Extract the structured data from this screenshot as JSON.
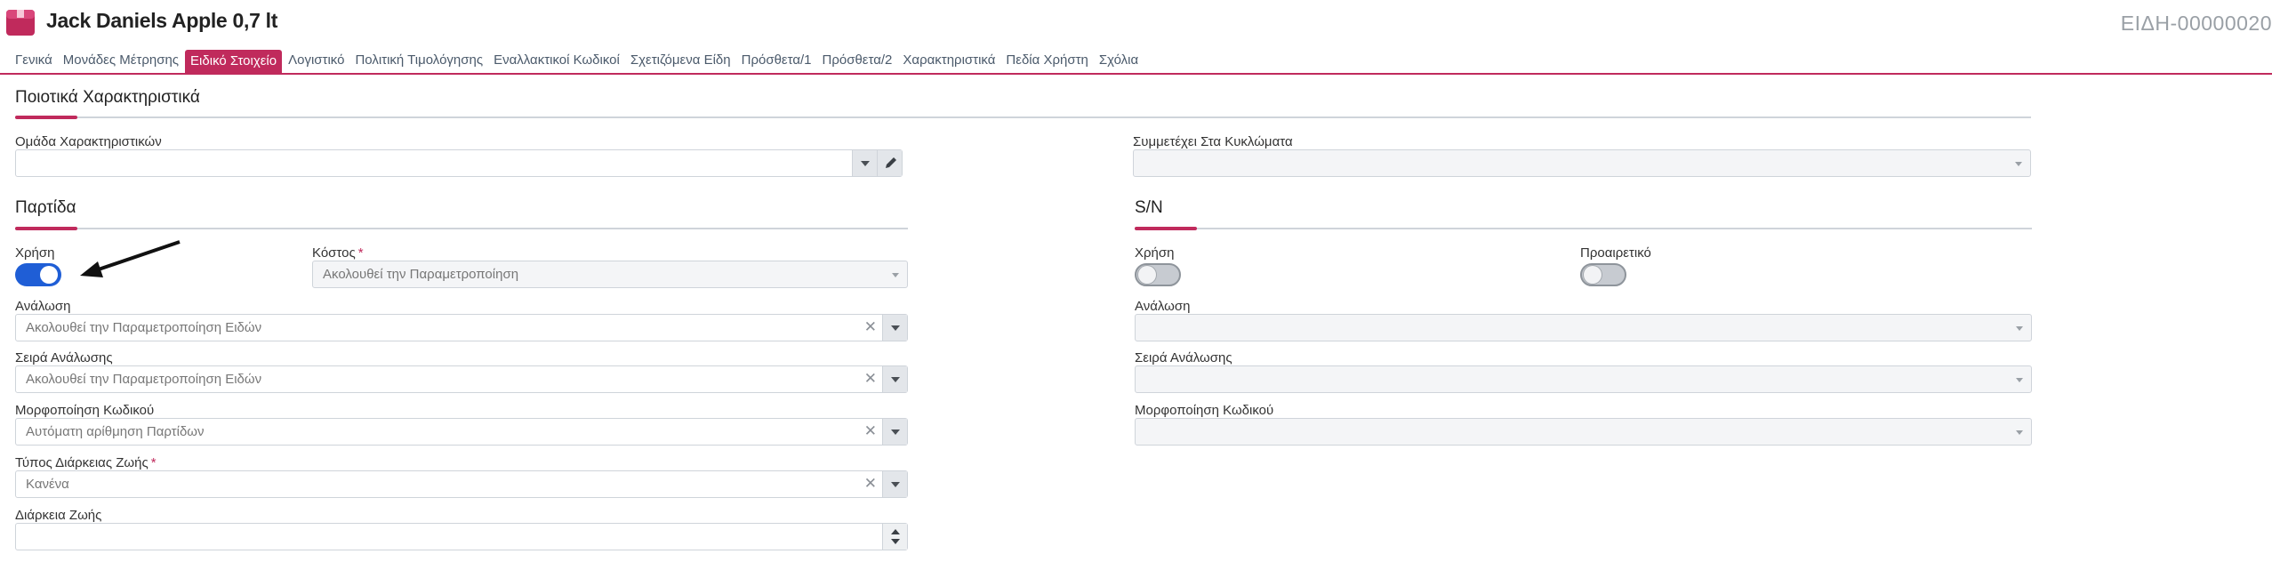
{
  "header": {
    "title": "Jack Daniels Apple 0,7 lt",
    "record_code": "ΕΙΔΗ-00000020",
    "icon": "product-box-icon",
    "icon_color": "#c02a5c"
  },
  "tabs": [
    {
      "label": "Γενικά"
    },
    {
      "label": "Μονάδες Μέτρησης"
    },
    {
      "label": "Ειδικό Στοιχείο"
    },
    {
      "label": "Λογιστικό"
    },
    {
      "label": "Πολιτική Τιμολόγησης"
    },
    {
      "label": "Εναλλακτικοί Κωδικοί"
    },
    {
      "label": "Σχετιζόμενα Είδη"
    },
    {
      "label": "Πρόσθετα/1"
    },
    {
      "label": "Πρόσθετα/2"
    },
    {
      "label": "Χαρακτηριστικά"
    },
    {
      "label": "Πεδία Χρήστη"
    },
    {
      "label": "Σχόλια"
    }
  ],
  "active_tab": "Ειδικό Στοιχείο",
  "accent_color": "#c02a5c",
  "quality": {
    "title": "Ποιοτικά Χαρακτηριστικά",
    "group_label": "Ομάδα Χαρακτηριστικών",
    "group_value": "",
    "cycles_label": "Συμμετέχει Στα Κυκλώματα",
    "cycles_value": ""
  },
  "batch": {
    "title": "Παρτίδα",
    "use_label": "Χρήση",
    "use_on": true,
    "cost_label": "Κόστος",
    "cost_value": "Ακολουθεί την Παραμετροποίηση",
    "analysis_label": "Ανάλωση",
    "analysis_value": "Ακολουθεί την Παραμετροποίηση Ειδών",
    "analysis_order_label": "Σειρά Ανάλωσης",
    "analysis_order_value": "Ακολουθεί την Παραμετροποίηση Ειδών",
    "code_format_label": "Μορφοποίηση Κωδικού",
    "code_format_value": "Αυτόματη αρίθμηση Παρτίδων",
    "lifetime_type_label": "Τύπος Διάρκειας Ζωής",
    "lifetime_type_value": "Κανένα",
    "lifetime_label": "Διάρκεια Ζωής",
    "lifetime_value": ""
  },
  "serial": {
    "title": "S/N",
    "use_label": "Χρήση",
    "use_on": false,
    "optional_label": "Προαιρετικό",
    "optional_on": false,
    "analysis_label": "Ανάλωση",
    "analysis_value": "",
    "analysis_order_label": "Σειρά Ανάλωσης",
    "analysis_order_value": "",
    "code_format_label": "Μορφοποίηση Κωδικού",
    "code_format_value": ""
  },
  "required_mark": "*"
}
